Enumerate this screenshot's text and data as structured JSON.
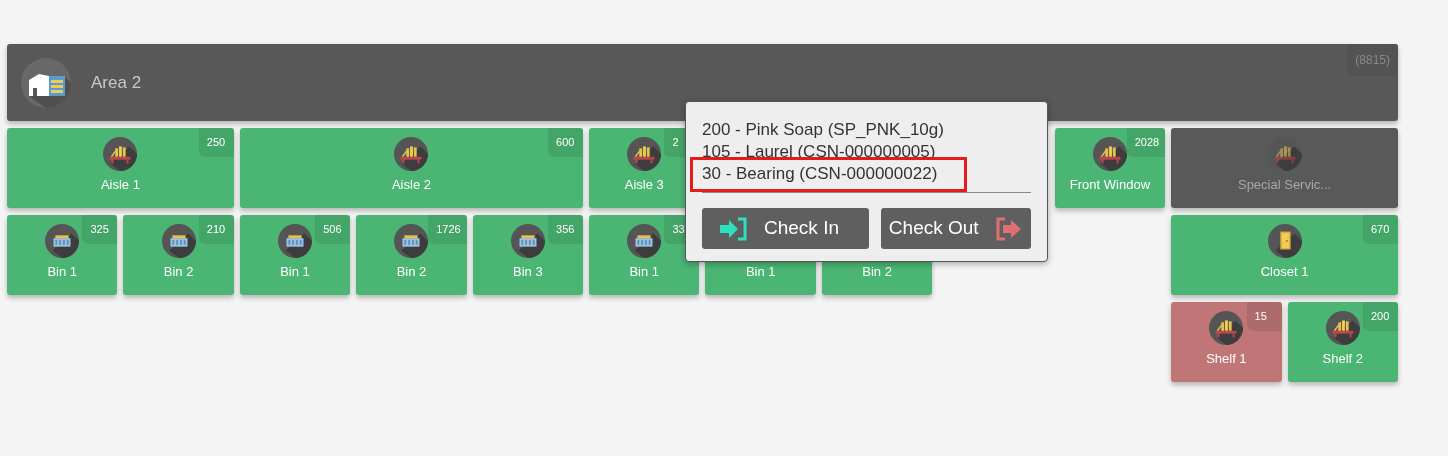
{
  "area": {
    "title": "Area 2",
    "count": "(8815)"
  },
  "tiles": [
    {
      "label": "Aisle 1",
      "count": "250",
      "kind": "shelf",
      "color": "#4bb673",
      "disabled": false
    },
    {
      "label": "Aisle 2",
      "count": "600",
      "kind": "shelf",
      "color": "#4bb673",
      "disabled": false
    },
    {
      "label": "Aisle 3",
      "count": "2",
      "kind": "shelf",
      "color": "#4bb673",
      "disabled": false
    },
    {
      "label": "Front Window",
      "count": "2028",
      "kind": "shelf",
      "color": "#4bb673",
      "disabled": false
    },
    {
      "label": "Special Servic...",
      "kind": "shelf",
      "color": "#595959",
      "disabled": true
    },
    {
      "label": "Bin 1",
      "count": "325",
      "kind": "bin",
      "color": "#4bb673",
      "disabled": false
    },
    {
      "label": "Bin 2",
      "count": "210",
      "kind": "bin",
      "color": "#4bb673",
      "disabled": false
    },
    {
      "label": "Bin 1",
      "count": "506",
      "kind": "bin",
      "color": "#4bb673",
      "disabled": false
    },
    {
      "label": "Bin 2",
      "count": "1726",
      "kind": "bin",
      "color": "#4bb673",
      "disabled": false
    },
    {
      "label": "Bin 3",
      "count": "356",
      "kind": "bin",
      "color": "#4bb673",
      "disabled": false
    },
    {
      "label": "Bin 1",
      "count": "33",
      "kind": "bin",
      "color": "#4bb673",
      "disabled": false
    },
    {
      "label": "Bin 1",
      "kind": "hidden",
      "color": "#4bb673",
      "disabled": false
    },
    {
      "label": "Bin 2",
      "kind": "hidden",
      "color": "#4bb673",
      "disabled": false
    },
    {
      "label": "Closet 1",
      "count": "670",
      "kind": "door",
      "color": "#4bb673",
      "disabled": false
    },
    {
      "label": "Shelf 1",
      "count": "15",
      "kind": "shelf",
      "color": "#c07676",
      "disabled": false
    },
    {
      "label": "Shelf 2",
      "count": "200",
      "kind": "shelf",
      "color": "#4bb673",
      "disabled": false
    }
  ],
  "popup": {
    "items": [
      {
        "text": "200 - Pink Soap (SP_PNK_10g)",
        "highlighted": false
      },
      {
        "text": "105 - Laurel (CSN-000000005)",
        "highlighted": false
      },
      {
        "text": "30 - Bearing (CSN-000000022)",
        "highlighted": true
      }
    ],
    "buttons": [
      {
        "label": "Check In",
        "kind": "in"
      },
      {
        "label": "Check Out",
        "kind": "out"
      }
    ]
  }
}
